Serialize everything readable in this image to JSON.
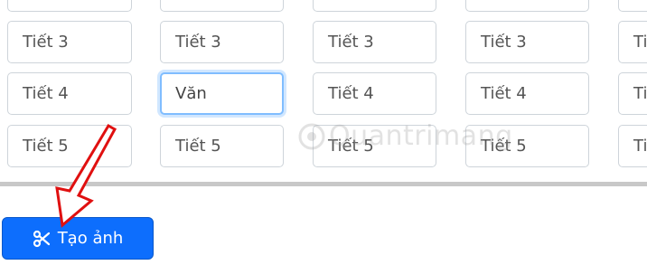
{
  "schedule": {
    "rows": [
      {
        "cells": [
          "",
          "",
          "",
          "",
          ""
        ]
      },
      {
        "cells": [
          "Tiết 3",
          "Tiết 3",
          "Tiết 3",
          "Tiết 3",
          "Tiế"
        ]
      },
      {
        "cells": [
          "Tiết 4",
          "Văn",
          "Tiết 4",
          "Tiết 4",
          "Tiế"
        ]
      },
      {
        "cells": [
          "Tiết 5",
          "Tiết 5",
          "Tiết 5",
          "Tiết 5",
          "Tiế"
        ]
      }
    ],
    "focused_cell": "row 3, column 2"
  },
  "actions": {
    "create_image_label": "Tạo ảnh",
    "create_image_icon": "scissors-icon",
    "button_color": "#0d6efd"
  },
  "overlay": {
    "watermark_text": "Quantrimang",
    "annotation": "red-arrow-pointing-to-button"
  }
}
